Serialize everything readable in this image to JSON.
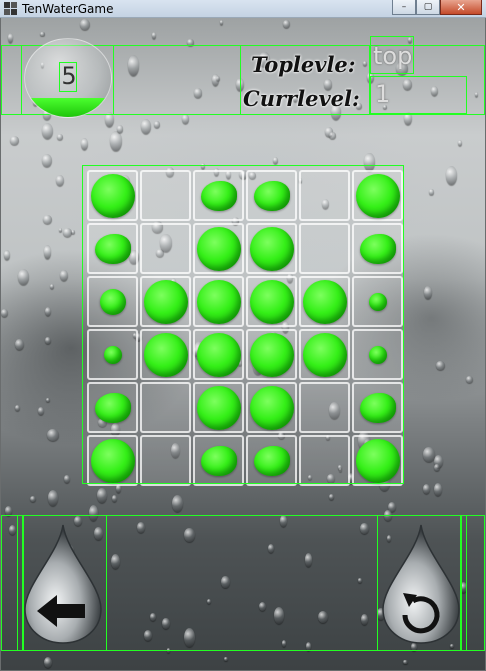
{
  "window": {
    "title": "TenWaterGame",
    "minimize": "–",
    "maximize": "▢",
    "close": "✕"
  },
  "hud": {
    "current_level_badge": "5",
    "top_label": "Toplevle:",
    "top_value": "top",
    "curr_label": "Currlevel:",
    "curr_value": "1",
    "water_fill_fraction": 0.25
  },
  "board": {
    "rows": 6,
    "cols": 6,
    "levels": [
      [
        4,
        0,
        3,
        3,
        0,
        4
      ],
      [
        3,
        0,
        4,
        4,
        0,
        3
      ],
      [
        2,
        4,
        4,
        4,
        4,
        1
      ],
      [
        1,
        4,
        4,
        4,
        4,
        1
      ],
      [
        3,
        0,
        4,
        4,
        0,
        3
      ],
      [
        4,
        0,
        3,
        3,
        0,
        4
      ]
    ]
  },
  "controls": {
    "back_icon": "back-arrow-icon",
    "restart_icon": "restart-icon"
  },
  "colors": {
    "water": "#35f018",
    "guide": "#22ff22"
  }
}
